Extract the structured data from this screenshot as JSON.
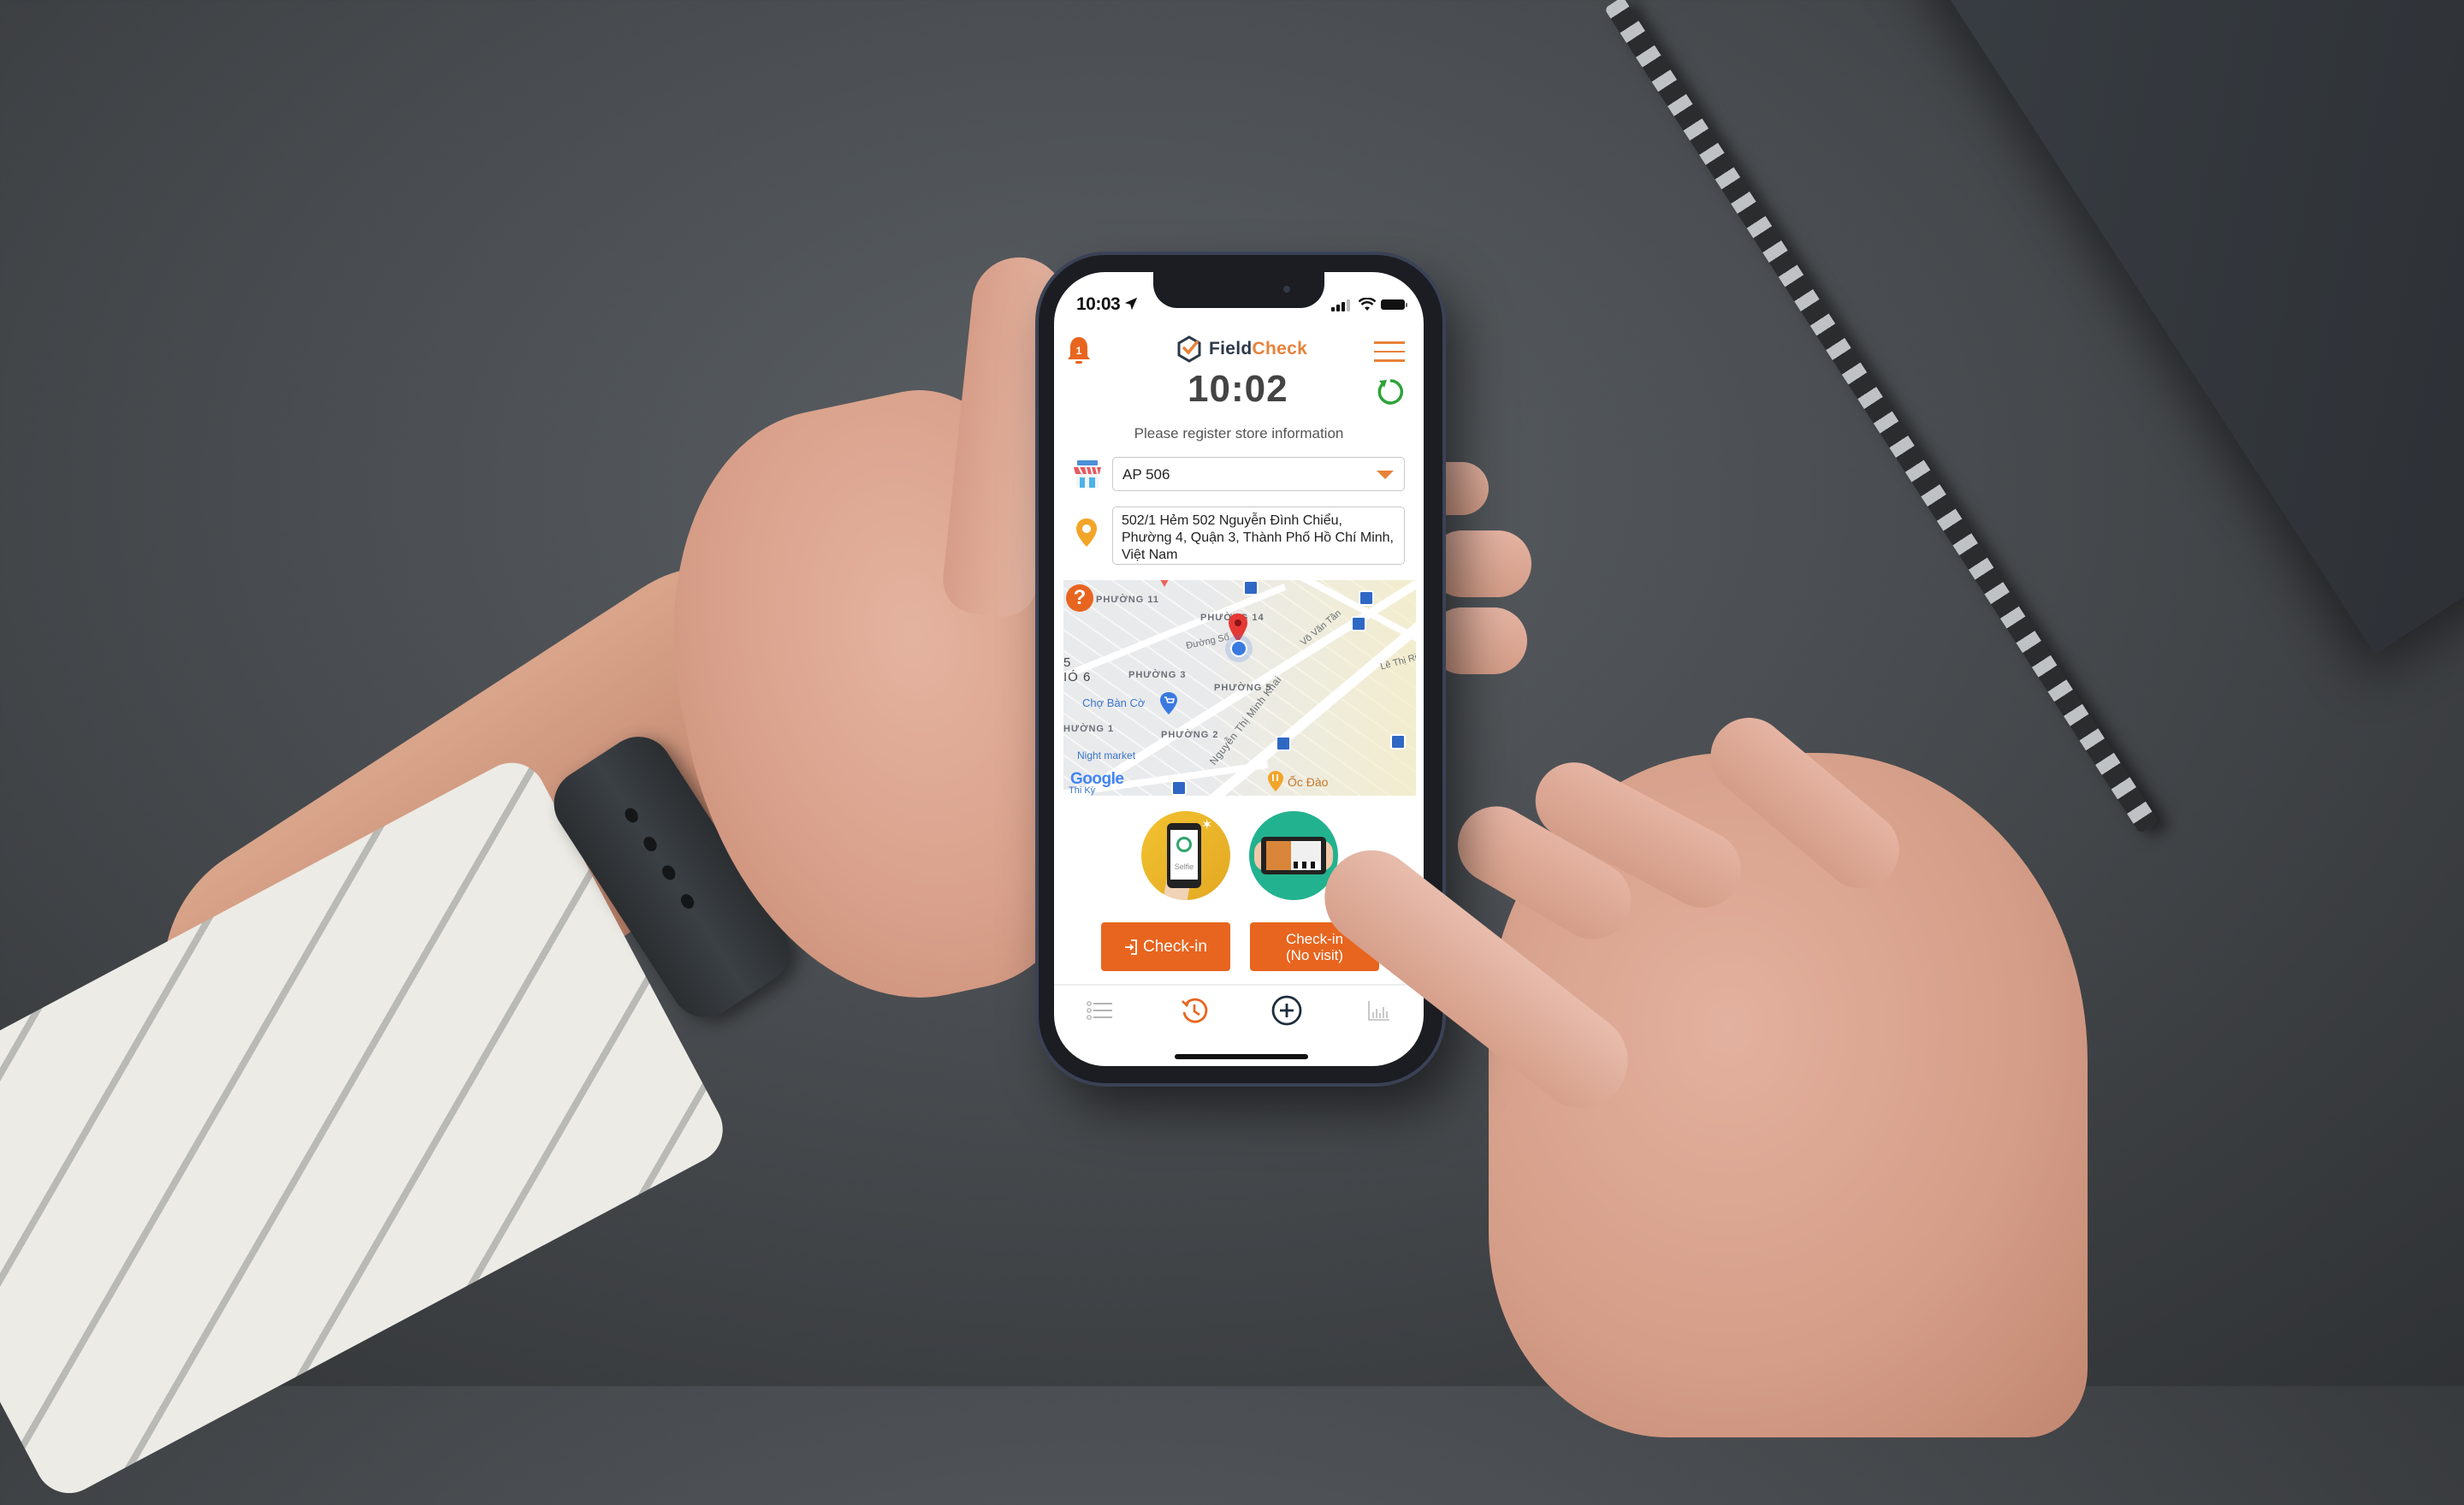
{
  "status_bar": {
    "time": "10:03",
    "location_icon": "location-arrow-icon",
    "signal_icon": "cellular-signal-icon",
    "wifi_icon": "wifi-icon",
    "battery_icon": "battery-full-icon"
  },
  "header": {
    "notification_badge_count": "1",
    "brand_part1": "Field",
    "brand_part2": "Check",
    "logo_icon": "fieldcheck-logo-icon",
    "menu_icon": "hamburger-menu-icon"
  },
  "clock": {
    "time": "10:02",
    "refresh_icon": "refresh-icon"
  },
  "form": {
    "instruction": "Please register store information",
    "store_select_value": "AP 506",
    "store_icon": "market-store-icon",
    "address_icon": "map-pin-icon",
    "address_value": "502/1 Hẻm 502 Nguyễn Đình Chiểu, Phường 4, Quận 3, Thành Phố Hồ Chí Minh, Việt Nam"
  },
  "map": {
    "help_label": "?",
    "labels": [
      "PHƯỜNG 11",
      "PHƯỜNG 14",
      "Đường Số",
      "Võ Văn Tần",
      "5",
      "IÓ 6",
      "PHƯỜNG 3",
      "PHƯỜNG 5",
      "Lê Thị Ri",
      "Nguyễn Thị Minh Khai",
      "HƯỜNG 1",
      "PHƯỜNG 2"
    ],
    "pois": {
      "market": "Chợ Bàn Cờ",
      "night_market": "Night market",
      "restaurant": "Ốc Đào",
      "bottom_label": "Thi Kỳ"
    },
    "attribution": "Google"
  },
  "actions": {
    "selfie_label": "Selfie",
    "checkin_label": "Check-in",
    "checkin_icon": "sign-in-icon",
    "novisit_line1": "Check-in",
    "novisit_line2": "(No visit)"
  },
  "tabbar": {
    "items": [
      {
        "name": "list",
        "icon": "list-icon",
        "active": false
      },
      {
        "name": "history",
        "icon": "history-icon",
        "active": true
      },
      {
        "name": "add",
        "icon": "add-circle-icon",
        "active": false
      },
      {
        "name": "report",
        "icon": "bar-chart-icon",
        "active": false
      }
    ]
  },
  "colors": {
    "accent": "#e8651f",
    "brand_orange": "#e8823a",
    "brand_navy": "#2c3848",
    "refresh_green": "#2ea33a",
    "pin_yellow": "#f2a529"
  }
}
